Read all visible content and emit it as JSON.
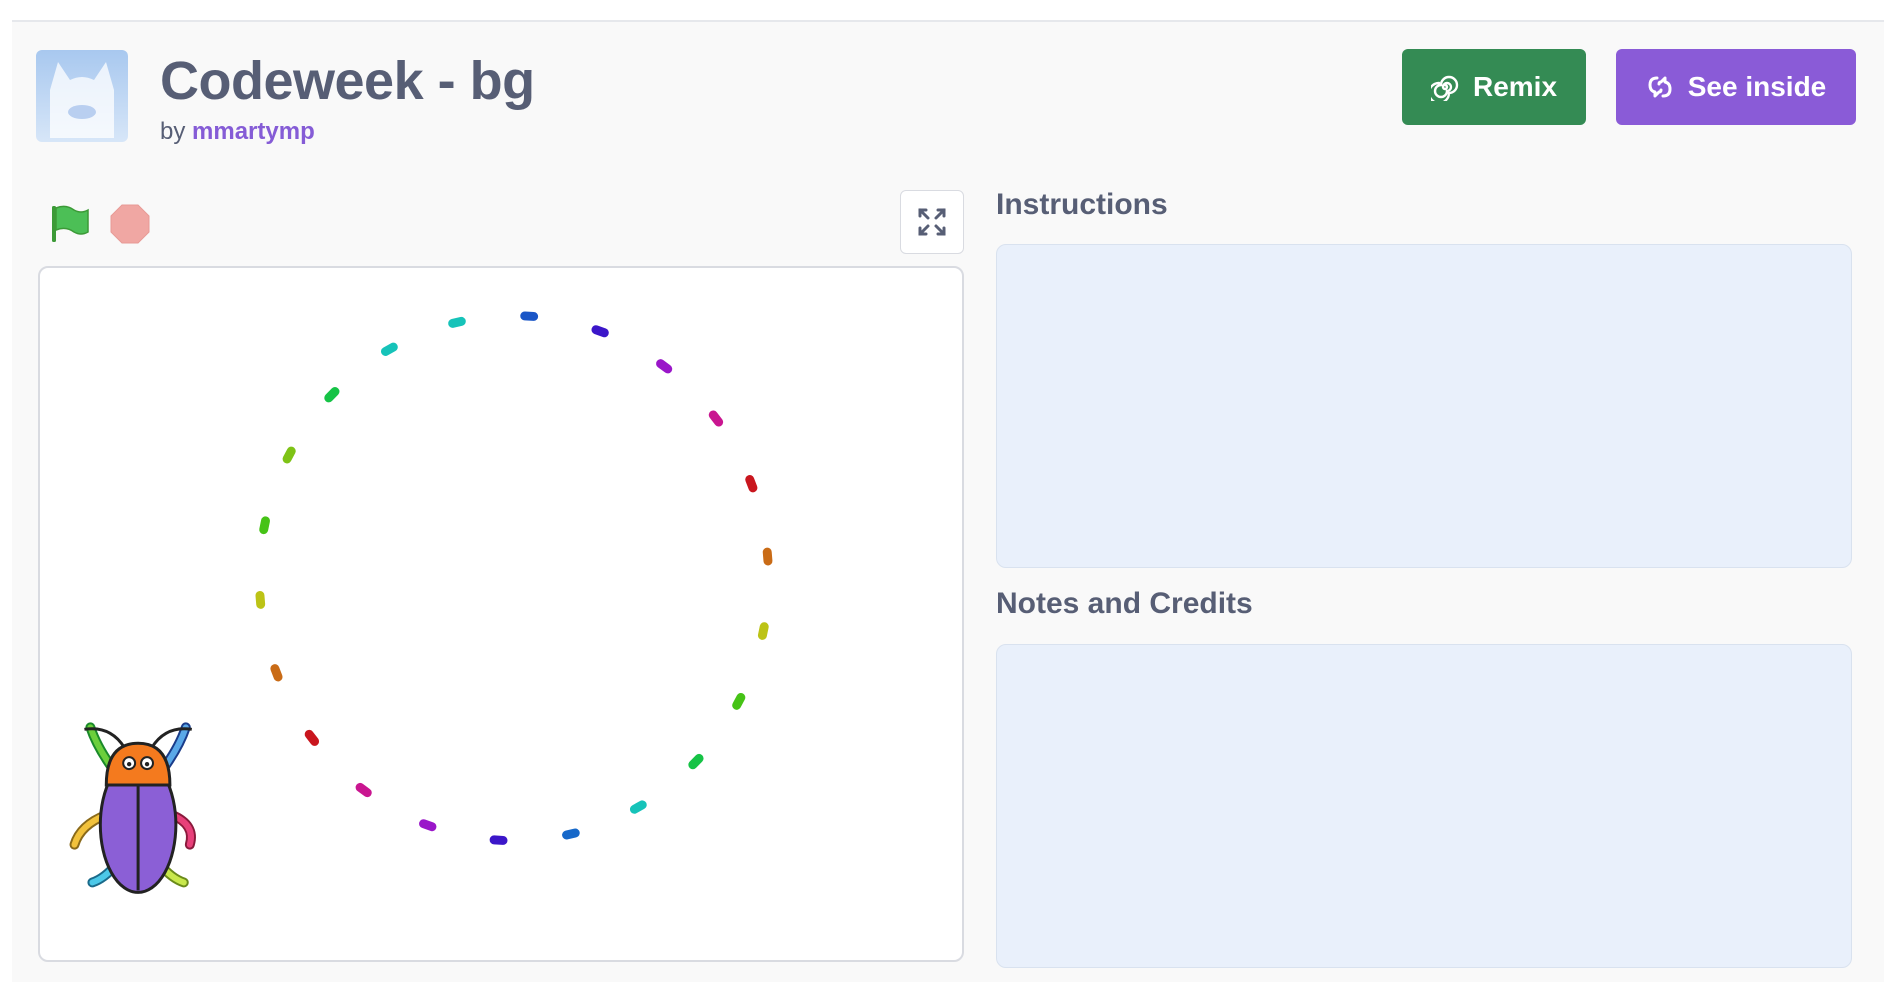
{
  "project": {
    "title": "Codeweek - bg",
    "by_label": "by",
    "author": "mmartymp"
  },
  "buttons": {
    "remix_label": "Remix",
    "see_inside_label": "See inside"
  },
  "instructions": {
    "heading": "Instructions",
    "text": ""
  },
  "notes": {
    "heading": "Notes and Credits",
    "text": ""
  },
  "icons": {
    "flag": "green-flag-icon",
    "stop": "stop-icon",
    "fullscreen": "fullscreen-icon",
    "remix": "remix-spiral-icon",
    "see_inside": "see-inside-icon",
    "thumbnail": "cat-thumbnail"
  },
  "colors": {
    "remix_green": "#348b54",
    "see_inside_purple": "#8a5bd7",
    "author_link": "#855cd6",
    "text_dark": "#575e75",
    "box_fill": "#e9f0fb"
  },
  "stage_drawing": {
    "description_free_sprite": "beetle",
    "dash_colors": [
      "#1a56c7",
      "#3b16c9",
      "#9a16c9",
      "#c91690",
      "#c9161e",
      "#c96b16",
      "#bcc316",
      "#46c316",
      "#16c346",
      "#16c3b9",
      "#1668c9",
      "#3b16c9",
      "#9a16c9",
      "#c91690",
      "#c9161e",
      "#c96b16",
      "#bcc316",
      "#46c316",
      "#7ec316",
      "#16c346",
      "#16c3b9",
      "#16c3b9"
    ]
  }
}
